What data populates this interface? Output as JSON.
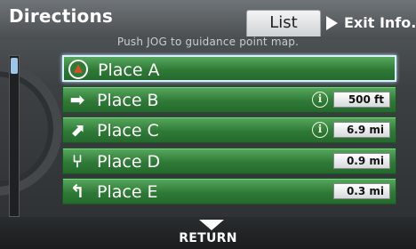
{
  "header": {
    "title": "Directions",
    "list_tab": "List",
    "exit_info": "Exit Info.",
    "hint": "Push JOG to guidance point map."
  },
  "rows": [
    {
      "label": "Place A",
      "icon": "destination-flag-icon",
      "distance": "",
      "info": false,
      "selected": true
    },
    {
      "label": "Place B",
      "icon": "turn-right-icon",
      "distance": "500 ft",
      "info": true,
      "selected": false
    },
    {
      "label": "Place C",
      "icon": "bear-right-icon",
      "distance": "6.9 mi",
      "info": true,
      "selected": false
    },
    {
      "label": "Place D",
      "icon": "fork-right-icon",
      "distance": "0.9 mi",
      "info": false,
      "selected": false
    },
    {
      "label": "Place E",
      "icon": "turn-left-icon",
      "distance": "0.3 mi",
      "info": false,
      "selected": false
    }
  ],
  "info_glyph": "i",
  "footer": {
    "return_label": "RETURN"
  },
  "colors": {
    "row_green": "#2f7a37",
    "selection_border": "#d8f1ff",
    "scroll_thumb": "#9ec6e8"
  }
}
